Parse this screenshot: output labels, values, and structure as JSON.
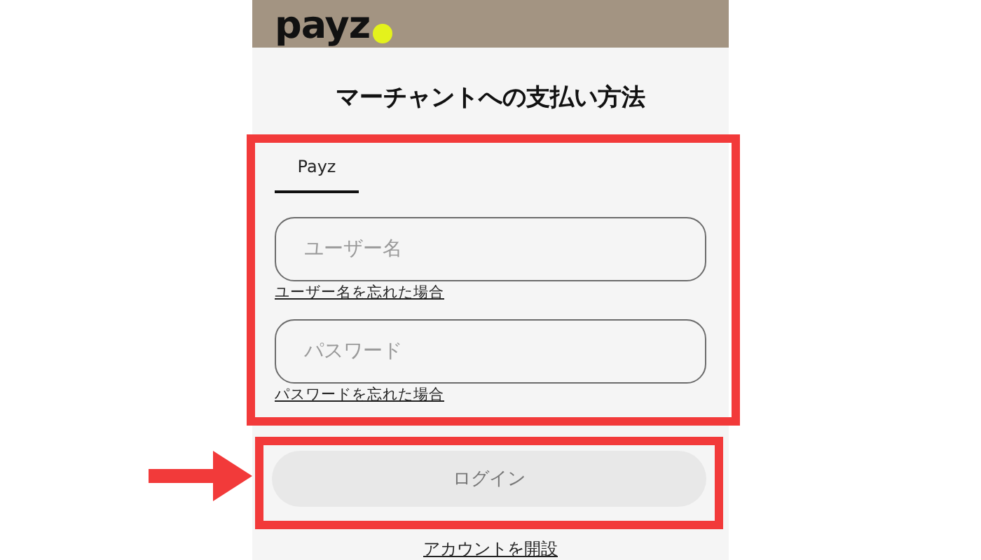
{
  "header": {
    "logo": "payz"
  },
  "title": "マーチャントへの支払い方法",
  "tabs": [
    {
      "label": "Payz",
      "selected": true
    }
  ],
  "fields": [
    {
      "placeholder": "ユーザー名",
      "link": "ユーザー名を忘れた場合"
    },
    {
      "placeholder": "パスワード",
      "link": "パスワードを忘れた場合"
    }
  ],
  "login_button": {
    "label": "ログイン",
    "disabled": true
  },
  "signup_link": "アカウントを開設"
}
